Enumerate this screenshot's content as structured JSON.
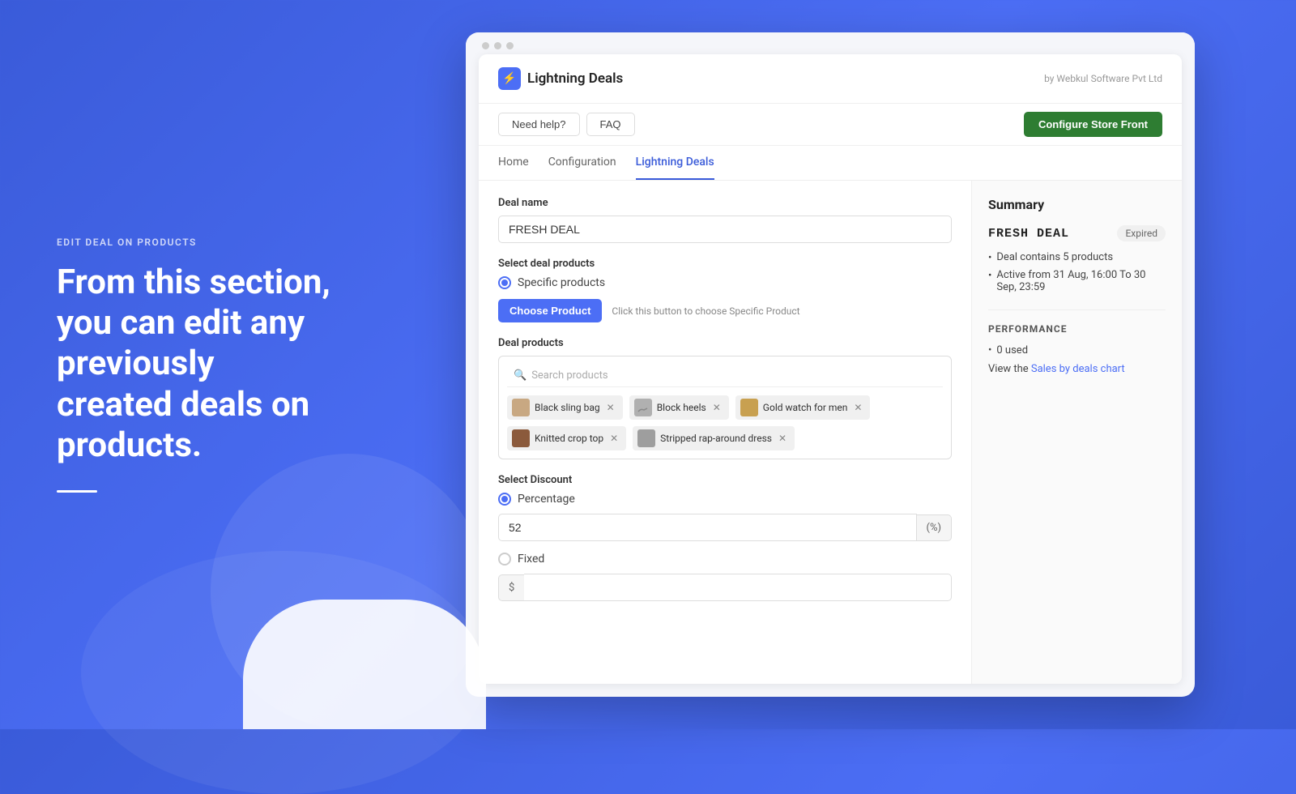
{
  "left": {
    "eyebrow": "EDIT DEAL ON PRODUCTS",
    "heading": "From this section, you can edit any previously created deals on products."
  },
  "app": {
    "logo_text": "Lightning Deals",
    "logo_icon": "⚡",
    "by_text": "by Webkul Software Pvt Ltd",
    "help_btn": "Need help?",
    "faq_btn": "FAQ",
    "configure_btn": "Configure Store Front"
  },
  "nav": {
    "tabs": [
      "Home",
      "Configuration",
      "Lightning Deals"
    ]
  },
  "form": {
    "deal_name_label": "Deal name",
    "deal_name_value": "FRESH DEAL",
    "select_products_label": "Select deal products",
    "specific_products_label": "Specific products",
    "choose_product_btn": "Choose Product",
    "choose_hint": "Click this button to choose Specific Product",
    "deal_products_label": "Deal products",
    "search_placeholder": "Search products",
    "products": [
      {
        "name": "Black sling bag",
        "color": "#c8a882"
      },
      {
        "name": "Block heels",
        "color": "#b0b0b0"
      },
      {
        "name": "Gold watch for men",
        "color": "#c8a050"
      },
      {
        "name": "Knitted crop top",
        "color": "#8b5a3c"
      },
      {
        "name": "Stripped rap-around dress",
        "color": "#9e9e9e"
      }
    ],
    "select_discount_label": "Select Discount",
    "percentage_label": "Percentage",
    "percentage_value": "52",
    "percentage_suffix": "(%)",
    "fixed_label": "Fixed",
    "fixed_prefix": "$"
  },
  "summary": {
    "title": "Summary",
    "deal_name": "FRESH DEAL",
    "badge": "Expired",
    "bullets": [
      "Deal contains 5 products",
      "Active from 31 Aug, 16:00 To 30 Sep, 23:59"
    ],
    "perf_title": "PERFORMANCE",
    "used_text": "0 used",
    "chart_prefix": "View the ",
    "chart_link_text": "Sales by deals chart"
  }
}
